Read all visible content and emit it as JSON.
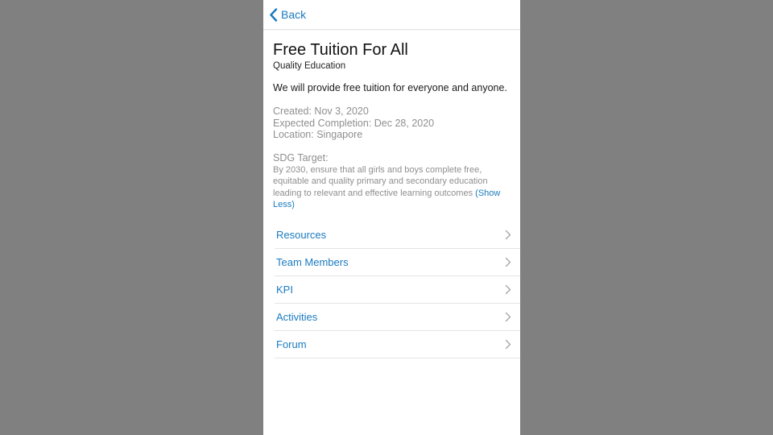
{
  "nav": {
    "back_label": "Back"
  },
  "project": {
    "title": "Free Tuition For All",
    "subtitle": "Quality Education",
    "description": "We will provide free tuition for everyone and anyone.",
    "created": "Created: Nov 3, 2020",
    "expected_completion": "Expected Completion: Dec 28, 2020",
    "location": "Location: Singapore"
  },
  "sdg": {
    "label": "SDG Target:",
    "text": "By 2030, ensure that all girls and boys complete free, equitable and quality primary and secondary education leading to relevant and effective learning outcomes",
    "toggle_label": "Show Less"
  },
  "menu": {
    "items": [
      {
        "label": "Resources"
      },
      {
        "label": "Team Members"
      },
      {
        "label": "KPI"
      },
      {
        "label": "Activities"
      },
      {
        "label": "Forum"
      }
    ]
  },
  "colors": {
    "accent": "#1a7bbf",
    "backdrop": "#808080",
    "muted_text": "#8f8f8f"
  },
  "icons": {
    "back": "chevron-left-icon",
    "row": "chevron-right-icon"
  }
}
